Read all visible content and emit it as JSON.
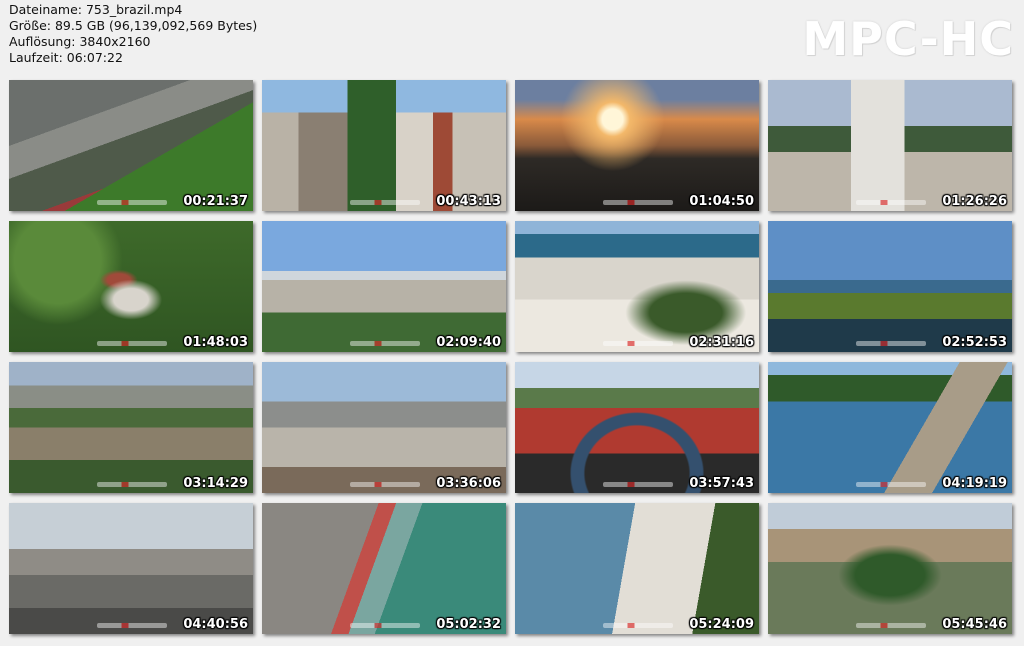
{
  "file_info": {
    "filename": "Dateiname: 753_brazil.mp4",
    "size": "Größe: 89.5 GB (96,139,092,569 Bytes)",
    "resolution": "Auflösung: 3840x2160",
    "duration": "Laufzeit: 06:07:22"
  },
  "logo": "MPC-HC",
  "thumbnails": [
    {
      "timestamp": "00:21:37"
    },
    {
      "timestamp": "00:43:13"
    },
    {
      "timestamp": "01:04:50"
    },
    {
      "timestamp": "01:26:26"
    },
    {
      "timestamp": "01:48:03"
    },
    {
      "timestamp": "02:09:40"
    },
    {
      "timestamp": "02:31:16"
    },
    {
      "timestamp": "02:52:53"
    },
    {
      "timestamp": "03:14:29"
    },
    {
      "timestamp": "03:36:06"
    },
    {
      "timestamp": "03:57:43"
    },
    {
      "timestamp": "04:19:19"
    },
    {
      "timestamp": "04:40:56"
    },
    {
      "timestamp": "05:02:32"
    },
    {
      "timestamp": "05:24:09"
    },
    {
      "timestamp": "05:45:46"
    }
  ]
}
